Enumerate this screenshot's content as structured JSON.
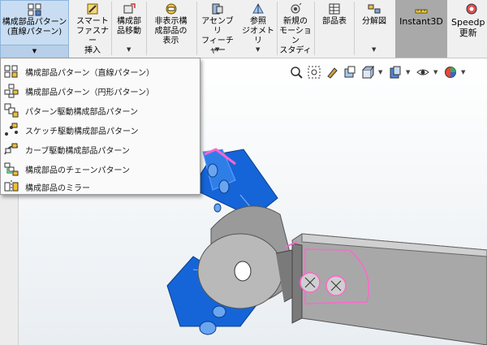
{
  "ribbon": {
    "pattern_button": "構成部品パターン\n(直線パターン)",
    "smart_fastener": "スマート\nファスナー\n挿入",
    "move_component": "構成部\n品移動",
    "show_hidden": "非表示構\n成部品の\n表示",
    "assembly_features": "アセンブリ\nフィーチャー",
    "reference_geometry": "参照\nジオメトリ",
    "new_motion_study": "新規の\nモーション\nスタディ",
    "bom": "部品表",
    "exploded_view": "分解図",
    "instant3d": "Instant3D",
    "speedpak": "Speedp\n更新"
  },
  "menu": {
    "items": [
      {
        "label": "構成部品パターン（直線パターン）",
        "icon": "linear-pattern-icon"
      },
      {
        "label": "構成部品パターン（円形パターン）",
        "icon": "circular-pattern-icon"
      },
      {
        "label": "パターン駆動構成部品パターン",
        "icon": "pattern-driven-icon"
      },
      {
        "label": "スケッチ駆動構成部品パターン",
        "icon": "sketch-driven-icon"
      },
      {
        "label": "カーブ駆動構成部品パターン",
        "icon": "curve-driven-icon"
      },
      {
        "label": "構成部品のチェーンパターン",
        "icon": "chain-pattern-icon"
      },
      {
        "label": "構成部品のミラー",
        "icon": "mirror-component-icon"
      }
    ]
  },
  "colors": {
    "accent": "#0a64e6",
    "highlight": "#ff66cc",
    "ribbon_bg": "#f0f0f0",
    "instant3d_bg": "#a9a9a9"
  }
}
